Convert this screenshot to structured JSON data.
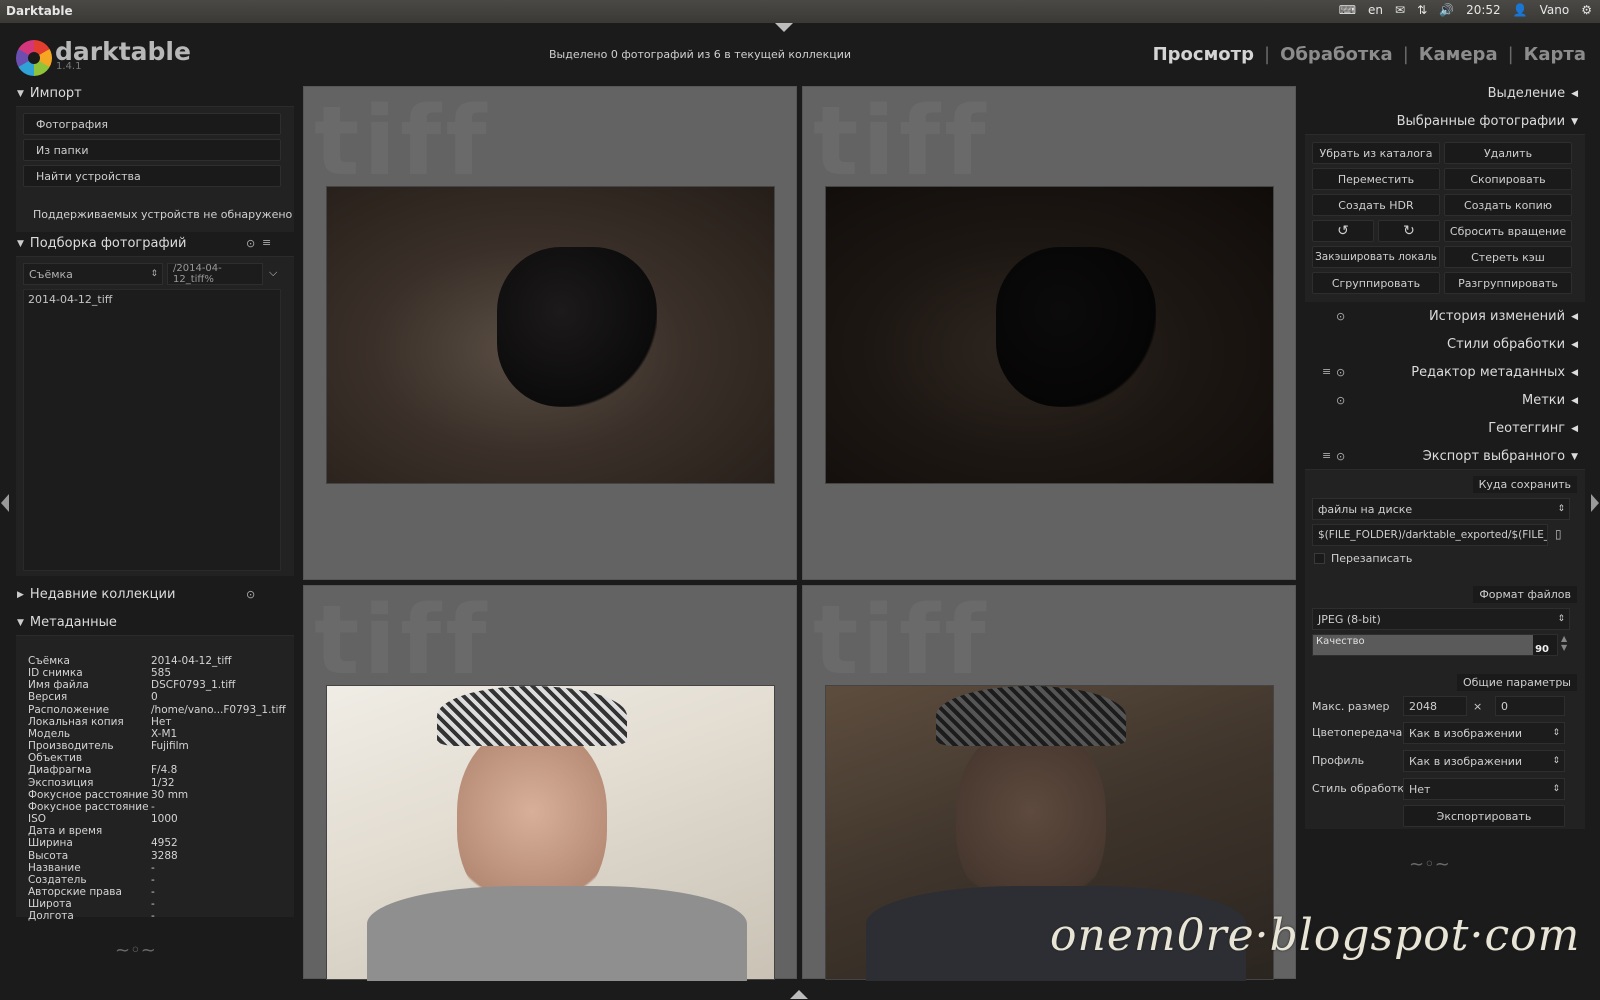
{
  "topbar": {
    "title": "Darktable",
    "lang": "en",
    "time": "20:52",
    "user": "Vano"
  },
  "app": {
    "name": "darktable",
    "version": "1.4.1",
    "status": "Выделено 0 фотографий из 6 в текущей коллекции"
  },
  "views": [
    {
      "label": "Просмотр",
      "active": true
    },
    {
      "label": "Обработка"
    },
    {
      "label": "Камера"
    },
    {
      "label": "Карта"
    }
  ],
  "left": {
    "import": {
      "title": "Импорт",
      "buttons": [
        "Фотография",
        "Из папки",
        "Найти устройства"
      ],
      "no_devices": "Поддерживаемых устройств не обнаружено"
    },
    "collect": {
      "title": "Подборка фотографий",
      "property": "Съёмка",
      "rule": "/2014-04-12_tiff%",
      "items": [
        "2014-04-12_tiff"
      ]
    },
    "recent": {
      "title": "Недавние коллекции"
    },
    "metadata": {
      "title": "Метаданные",
      "rows": [
        {
          "k": "Съёмка",
          "v": "2014-04-12_tiff"
        },
        {
          "k": "ID снимка",
          "v": "585"
        },
        {
          "k": "Имя файла",
          "v": "DSCF0793_1.tiff"
        },
        {
          "k": "Версия",
          "v": "0"
        },
        {
          "k": "Расположение",
          "v": "/home/vano...F0793_1.tiff"
        },
        {
          "k": "Локальная копия",
          "v": "Нет"
        },
        {
          "k": "Модель",
          "v": "X-M1"
        },
        {
          "k": "Производитель",
          "v": "Fujifilm"
        },
        {
          "k": "Объектив",
          "v": ""
        },
        {
          "k": "Диафрагма",
          "v": "F/4.8"
        },
        {
          "k": "Экспозиция",
          "v": "1/32"
        },
        {
          "k": "Фокусное расстояние",
          "v": "30 mm"
        },
        {
          "k": "Фокусное расстояние",
          "v": "-"
        },
        {
          "k": "ISO",
          "v": "1000"
        },
        {
          "k": "Дата и время",
          "v": ""
        },
        {
          "k": "Ширина",
          "v": "4952"
        },
        {
          "k": "Высота",
          "v": "3288"
        },
        {
          "k": "Название",
          "v": "-"
        },
        {
          "k": "Создатель",
          "v": "-"
        },
        {
          "k": "Авторские права",
          "v": "-"
        },
        {
          "k": "Широта",
          "v": "-"
        },
        {
          "k": "Долгота",
          "v": "-"
        }
      ]
    }
  },
  "center": {
    "watermark": "tiff"
  },
  "right": {
    "select": "Выделение",
    "selected": {
      "title": "Выбранные фотографии",
      "buttons": [
        "Убрать из каталога",
        "Удалить",
        "Переместить",
        "Скопировать",
        "Создать HDR",
        "Создать копию",
        "↺",
        "↻",
        "Сбросить вращение",
        "Закэшировать локаль",
        "Стереть кэш",
        "Сгруппировать",
        "Разгруппировать"
      ]
    },
    "history": "История изменений",
    "styles": "Стили обработки",
    "meta_editor": "Редактор метаданных",
    "tags": "Метки",
    "geotag": "Геотеггинг",
    "export": {
      "title": "Экспорт выбранного",
      "target_header": "Куда сохранить",
      "storage": "файлы на диске",
      "path": "$(FILE_FOLDER)/darktable_exported/$(FILE_N",
      "overwrite": "Перезаписать",
      "format_header": "Формат файлов",
      "format": "JPEG (8-bit)",
      "quality_label": "Качество",
      "quality_value": "90",
      "quality_fraction": 0.9,
      "global_header": "Общие параметры",
      "max_size_label": "Макс. размер",
      "max_w": "2048",
      "times": "×",
      "max_h": "0",
      "intent_label": "Цветопередача",
      "intent_value": "Как в изображении",
      "profile_label": "Профиль",
      "profile_value": "Как в изображении",
      "style_label": "Стиль обработки",
      "style_value": "Нет",
      "export_button": "Экспортировать"
    }
  },
  "watermark": "onem0re·blogspot·com"
}
